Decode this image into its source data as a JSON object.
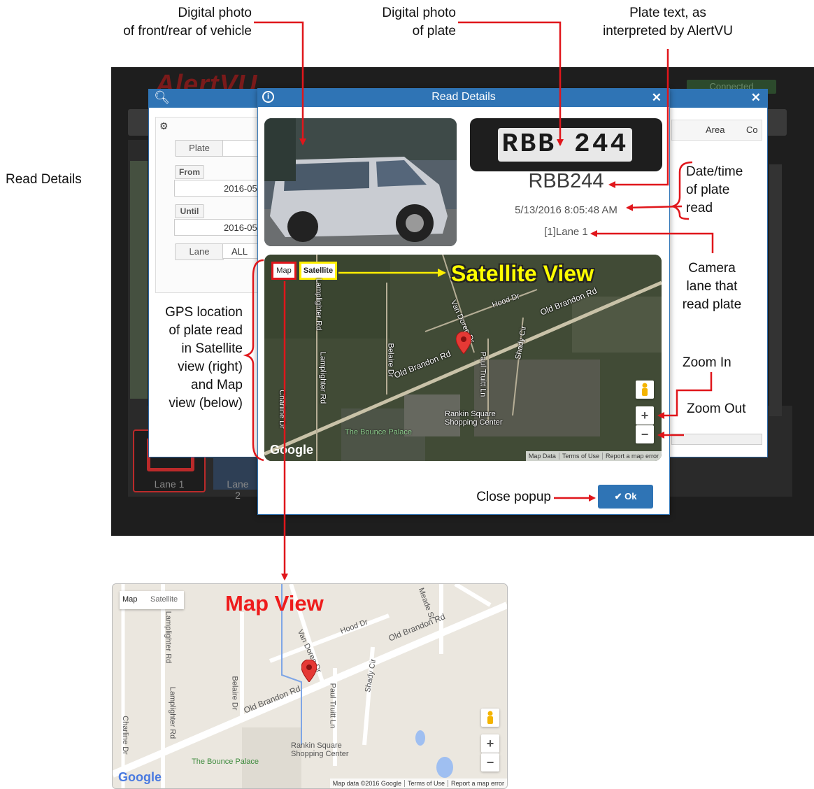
{
  "annotations": {
    "vehicle_photo": "Digital photo\nof front/rear of vehicle",
    "vehicle_photo_line1": "Digital photo",
    "vehicle_photo_line2": "of front/rear of vehicle",
    "plate_photo_line1": "Digital photo",
    "plate_photo_line2": "of plate",
    "plate_text_line1": "Plate text, as",
    "plate_text_line2": "interpreted by AlertVU",
    "read_details": "Read Details",
    "date_time_line1": "Date/time",
    "date_time_line2": "of plate",
    "date_time_line3": "read",
    "camera_lane_line1": "Camera",
    "camera_lane_line2": "lane that",
    "camera_lane_line3": "read plate",
    "zoom_in": "Zoom In",
    "zoom_out": "Zoom Out",
    "gps_line1": "GPS location",
    "gps_line2": "of plate read",
    "gps_line3": "in Satellite",
    "gps_line4": "view (right)",
    "gps_line5": "and Map",
    "gps_line6": "view (below)",
    "close_popup": "Close popup",
    "satellite_view": "Satellite View",
    "map_view": "Map View"
  },
  "app": {
    "logo": "AlertVU",
    "connection_status": "Connected",
    "lane_tiles": [
      "Lane 1",
      "Lane 2"
    ]
  },
  "search_panel": {
    "fields": {
      "plate_label": "Plate",
      "from_label": "From",
      "from_value": "2016-05",
      "until_label": "Until",
      "until_value": "2016-05",
      "lane_label": "Lane",
      "lane_value": "ALL"
    },
    "grid_columns": [
      "Area",
      "Co"
    ]
  },
  "modal": {
    "title": "Read Details",
    "plate_image_text": "RBB  244",
    "plate_text": "RBB244",
    "read_time": "5/13/2016 8:05:48 AM",
    "lane": "[1]Lane 1",
    "ok_label": "Ok"
  },
  "map": {
    "map_button": "Map",
    "satellite_button": "Satellite",
    "zoom_in": "+",
    "zoom_out": "−",
    "google": "Google",
    "footer": [
      "Map Data",
      "Terms of Use",
      "Report a map error"
    ],
    "streets": {
      "hood": "Hood Dr",
      "old_brandon_upper": "Old Brandon Rd",
      "old_brandon_lower": "Old Brandon Rd",
      "van_doren": "Van Doren Dr",
      "lamplighter": "Lamplighter Rd",
      "lamplighter2": "Lamplighter Rd",
      "belaire": "Belaire Dr",
      "paul_truitt": "Paul Truitt Ln",
      "shady": "Shady Cir",
      "charline": "Charline Dr",
      "rankin1": "Rankin Square",
      "rankin2": "Shopping Center",
      "bounce": "The Bounce Palace",
      "meade": "Meade St"
    }
  },
  "plain_map": {
    "map_button": "Map",
    "satellite_button": "Satellite",
    "google": "Google",
    "footer": [
      "Map data ©2016 Google",
      "Terms of Use",
      "Report a map error"
    ]
  },
  "colors": {
    "arrow": "#e0161b",
    "header_blue": "#2f74b5",
    "label_yellow": "#ffff00",
    "label_red": "#ee1c1c"
  }
}
